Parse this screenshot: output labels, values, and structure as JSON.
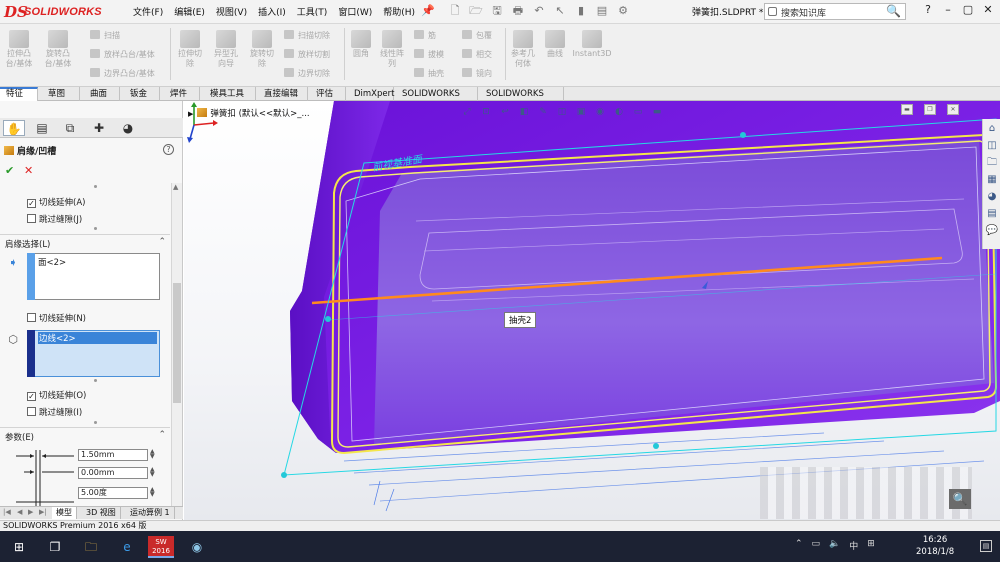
{
  "app": {
    "logo_mark": "DS",
    "logo_text": "SOLIDWORKS",
    "menus": [
      "文件(F)",
      "编辑(E)",
      "视图(V)",
      "插入(I)",
      "工具(T)",
      "窗口(W)",
      "帮助(H)"
    ],
    "document_name": "弹簧扣.SLDPRT *",
    "search_placeholder": "搜索知识库",
    "colors": {
      "accent": "#3a7bd5",
      "model_purple": "#7b1fe0",
      "edge_yellow": "#f4e64a",
      "edge_orange": "#ff8a1e",
      "plane_cyan": "#25d8e4"
    }
  },
  "commands": {
    "group1": [
      {
        "label": "拉伸凸\n台/基体",
        "icon": "extrude-boss-icon"
      },
      {
        "label": "旋转凸\n台/基体",
        "icon": "revolve-boss-icon"
      }
    ],
    "group1_rows": [
      "扫描",
      "放样凸台/基体",
      "边界凸台/基体"
    ],
    "group2": [
      {
        "label": "拉伸切\n除",
        "icon": "extrude-cut-icon"
      },
      {
        "label": "异型孔\n向导",
        "icon": "hole-wizard-icon"
      },
      {
        "label": "旋转切\n除",
        "icon": "revolve-cut-icon"
      }
    ],
    "group2_rows": [
      "扫描切除",
      "放样切割",
      "边界切除"
    ],
    "group3": [
      {
        "label": "圆角",
        "icon": "fillet-icon"
      },
      {
        "label": "线性阵\n列",
        "icon": "linear-pattern-icon"
      }
    ],
    "group3_rows_a": [
      "筋",
      "拔模",
      "抽壳"
    ],
    "group3_rows_b": [
      "包覆",
      "相交",
      "镜向"
    ],
    "group4": [
      {
        "label": "参考几\n何体",
        "icon": "reference-geometry-icon"
      },
      {
        "label": "曲线",
        "icon": "curves-icon"
      },
      {
        "label": "Instant3D",
        "icon": "instant3d-icon"
      }
    ]
  },
  "tabs": [
    "特征",
    "草图",
    "曲面",
    "钣金",
    "焊件",
    "模具工具",
    "直接编辑",
    "评估",
    "DimXpert",
    "SOLIDWORKS 插件",
    "SOLIDWORKS MBD"
  ],
  "panel": {
    "title": "肩缘/凹槽",
    "opt_tangent_1": "切线延伸(A)",
    "opt_skip_1": "跳过缝隙(J)",
    "section_selection": "肩缘选择(L)",
    "face_item": "面<2>",
    "opt_tangent_2": "切线延伸(N)",
    "edge_item": "边线<2>",
    "opt_tangent_3": "切线延伸(O)",
    "opt_skip_3": "跳过缝隙(I)",
    "section_params": "参数(E)",
    "param_1": "1.50mm",
    "param_2": "0.00mm",
    "param_3": "5.00度"
  },
  "bottom_tabs": [
    "模型",
    "3D 视图",
    "运动算例 1"
  ],
  "status": "SOLIDWORKS Premium 2016 x64 版",
  "viewport": {
    "tree_item": "弹簧扣 (默认<<默认>_...",
    "plane_label": "前视基准面",
    "tooltip": "抽壳2"
  },
  "taskbar": {
    "sw_label": "SW\n2016",
    "ime": "中",
    "time": "16:26",
    "date": "2018/1/8"
  }
}
